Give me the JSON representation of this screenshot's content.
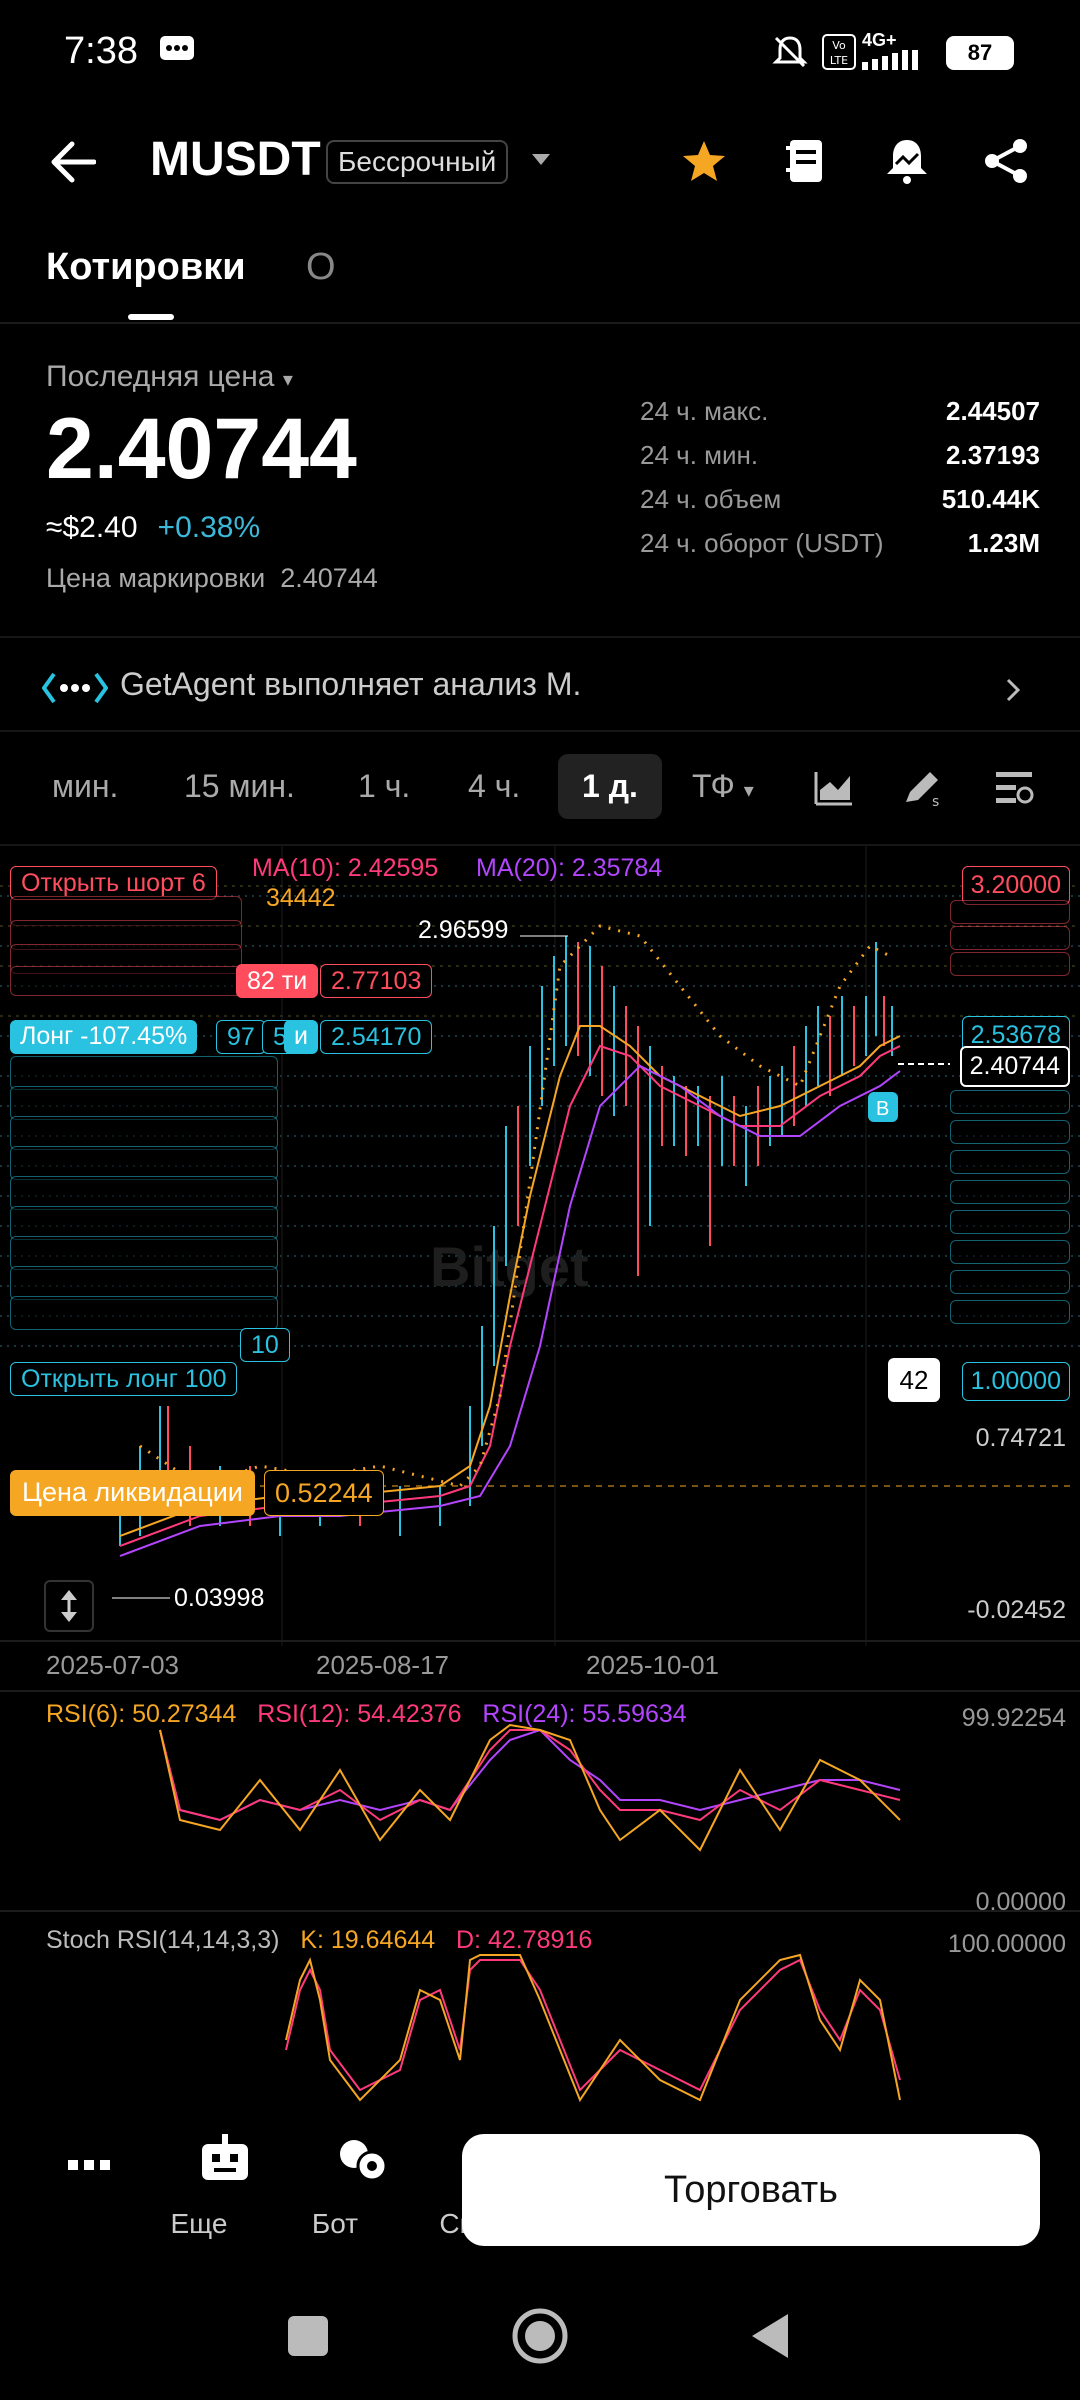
{
  "status": {
    "time": "7:38",
    "battery": "87",
    "network": "4G+"
  },
  "header": {
    "title": "MUSDT",
    "badge": "Бессрочный"
  },
  "tabs": [
    {
      "label": "Котировки"
    },
    {
      "label": "О"
    }
  ],
  "price": {
    "last_label": "Последняя цена",
    "last": "2.40744",
    "usd": "≈$2.40",
    "change": "+0.38%",
    "mark_label": "Цена маркировки",
    "mark_value": "2.40744"
  },
  "stats": [
    {
      "label": "24 ч. макс.",
      "value": "2.44507"
    },
    {
      "label": "24 ч. мин.",
      "value": "2.37193"
    },
    {
      "label": "24 ч. объем",
      "value": "510.44K"
    },
    {
      "label": "24 ч. оборот (USDT)",
      "value": "1.23M"
    }
  ],
  "agent": {
    "text": "GetAgent выполняет анализ M."
  },
  "intervals": [
    {
      "label": "мин."
    },
    {
      "label": "15 мин."
    },
    {
      "label": "1 ч."
    },
    {
      "label": "4 ч."
    },
    {
      "label": "1 д."
    },
    {
      "label": "ТФ"
    }
  ],
  "chart": {
    "ma10": "MA(10): 2.42595",
    "ma20": "MA(20): 2.35784",
    "ma5_partial": "34442",
    "high_label": "2.96599",
    "low_label": "0.03998",
    "short_tag": "Открыть шорт 6",
    "short_tag_value": "2.77103",
    "short_tag_value_prefix": "82",
    "short_tag_ti": "ти",
    "long_tag": "Лонг -107.45%",
    "long_tag_97": "97",
    "long_tag_5": "5",
    "long_tag_i": "и",
    "long_tag_value": "2.54170",
    "long_open": "Открыть лонг 100",
    "long_open_10": "10",
    "liq_label": "Цена ликвидации",
    "liq_value": "0.52244",
    "axis_top": "3.20000",
    "axis_2": "2.53678",
    "axis_current": "2.40744",
    "axis_1": "1.00000",
    "axis_074": "0.74721",
    "axis_neg": "-0.02452",
    "count_badge": "42",
    "b_marker": "B",
    "watermark": "Bitget",
    "x_labels": [
      "2025-07-03",
      "2025-08-17",
      "2025-10-01"
    ]
  },
  "rsi": {
    "r6": "RSI(6): 50.27344",
    "r12": "RSI(12): 54.42376",
    "r24": "RSI(24): 55.59634",
    "max": "99.92254",
    "min": "0.00000"
  },
  "stoch": {
    "name": "Stoch RSI(14,14,3,3)",
    "k": "K: 19.64644",
    "d": "D: 42.78916",
    "max": "100.00000"
  },
  "bottom_nav": [
    {
      "label": "Еще",
      "icon": "more-icon"
    },
    {
      "label": "Бот",
      "icon": "bot-icon"
    },
    {
      "label": "Спот",
      "icon": "spot-icon"
    }
  ],
  "trade_button": "Торговать",
  "colors": {
    "accent": "#3db8d9",
    "short": "#ff4d5e",
    "liq": "#f5a623"
  }
}
